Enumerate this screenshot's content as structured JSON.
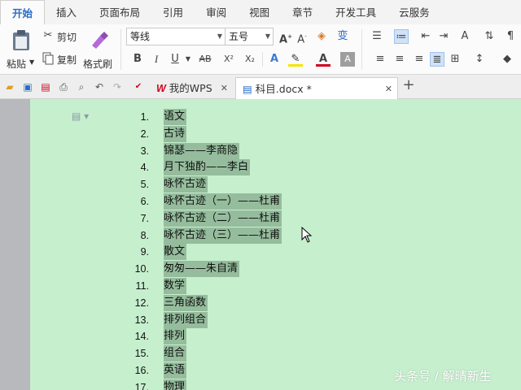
{
  "menu": {
    "tabs": [
      {
        "label": "开始",
        "active": true
      },
      {
        "label": "插入"
      },
      {
        "label": "页面布局"
      },
      {
        "label": "引用"
      },
      {
        "label": "审阅"
      },
      {
        "label": "视图"
      },
      {
        "label": "章节"
      },
      {
        "label": "开发工具"
      },
      {
        "label": "云服务"
      }
    ]
  },
  "ribbon": {
    "paste_label": "粘贴",
    "cut_label": "剪切",
    "copy_label": "复制",
    "format_painter_label": "格式刷",
    "font_name": "等线",
    "font_size": "五号",
    "bold": "B",
    "italic": "I",
    "underline": "U",
    "strike": "AB",
    "superscript": "X²",
    "subscript": "X₂"
  },
  "tabbar": {
    "wps_tab": "我的WPS",
    "doc_tab": "科目.docx *",
    "add": "+"
  },
  "document": {
    "items": [
      {
        "n": "1.",
        "text": "语文"
      },
      {
        "n": "2.",
        "text": "古诗"
      },
      {
        "n": "3.",
        "text": "锦瑟——李商隐"
      },
      {
        "n": "4.",
        "text": "月下独酌——李白"
      },
      {
        "n": "5.",
        "text": "咏怀古迹"
      },
      {
        "n": "6.",
        "text": "咏怀古迹（一）——杜甫"
      },
      {
        "n": "7.",
        "text": "咏怀古迹（二）——杜甫"
      },
      {
        "n": "8.",
        "text": "咏怀古迹（三）——杜甫"
      },
      {
        "n": "9.",
        "text": "散文"
      },
      {
        "n": "10.",
        "text": "匆匆——朱自清"
      },
      {
        "n": "11.",
        "text": "数学"
      },
      {
        "n": "12.",
        "text": "三角函数"
      },
      {
        "n": "13.",
        "text": "排列组合"
      },
      {
        "n": "14.",
        "text": "排列"
      },
      {
        "n": "15.",
        "text": "组合"
      },
      {
        "n": "16.",
        "text": "英语"
      },
      {
        "n": "17.",
        "text": "物理"
      }
    ]
  },
  "watermark": "头条号 / 解晴新生",
  "colors": {
    "page_bg": "#c6efce",
    "selection": "#95bd9d",
    "accent": "#2a6dc6",
    "wps_red": "#d0021b"
  }
}
